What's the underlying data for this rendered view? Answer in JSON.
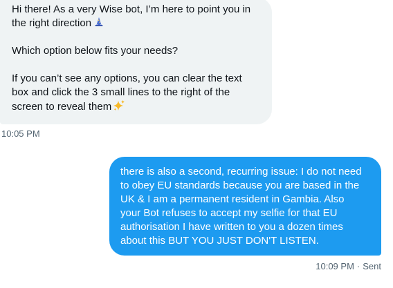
{
  "messages": {
    "incoming": {
      "paragraph_1": "Hi there! As a very Wise bot, I’m here to point you in\nthe right direction",
      "paragraph_1_icon": "wizard-icon",
      "paragraph_2": "Which option below fits your needs?",
      "paragraph_3": "If you can’t see any options, you can clear the text\nbox and click the 3 small lines to the right of the\nscreen to reveal them",
      "paragraph_3_icon": "sparkles-icon",
      "timestamp": "10:05 PM"
    },
    "outgoing": {
      "text": "there is also a second, recurring issue: I do not need\nto obey EU standards because you are based in the\nUK & I am a permanent resident in Gambia. Also\nyour Bot refuses to accept my selfie for that EU\nauthorisation I have written to you a dozen times\nabout this BUT YOU JUST DON'T LISTEN.",
      "timestamp": "10:09 PM",
      "status": "Sent"
    }
  },
  "colors": {
    "incoming_bubble": "#eff3f4",
    "outgoing_bubble": "#1d9bf0",
    "text_primary": "#0f1419",
    "text_secondary": "#536471"
  }
}
